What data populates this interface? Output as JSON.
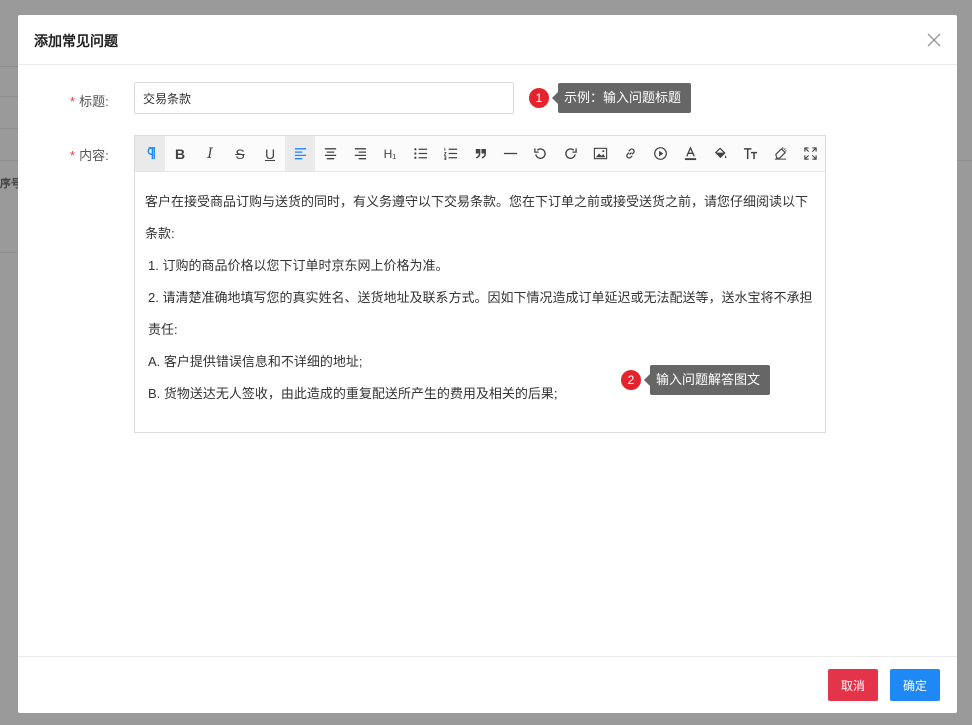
{
  "background": {
    "column_label": "序号"
  },
  "dialog": {
    "title": "添加常见问题",
    "close_icon": "close-icon"
  },
  "form": {
    "title_label": "标题:",
    "title_value": "交易条款",
    "content_label": "内容:",
    "required_mark": "*"
  },
  "tips": [
    {
      "badge": "1",
      "text": "示例：输入问题标题"
    },
    {
      "badge": "2",
      "text": "输入问题解答图文"
    }
  ],
  "toolbar": {
    "items": [
      {
        "name": "paragraph",
        "icon": "paragraph-icon"
      },
      {
        "name": "bold",
        "label": "B"
      },
      {
        "name": "italic",
        "label": "I"
      },
      {
        "name": "strikethrough",
        "label": "S"
      },
      {
        "name": "underline",
        "label": "U"
      },
      {
        "name": "align-left",
        "icon": "align-left-icon"
      },
      {
        "name": "align-center",
        "icon": "align-center-icon"
      },
      {
        "name": "align-right",
        "icon": "align-right-icon"
      },
      {
        "name": "heading",
        "label": "H₁"
      },
      {
        "name": "bulleted-list",
        "icon": "bulleted-list-icon"
      },
      {
        "name": "numbered-list",
        "icon": "numbered-list-icon"
      },
      {
        "name": "quote",
        "icon": "quote-icon"
      },
      {
        "name": "horizontal-rule",
        "icon": "horizontal-rule-icon"
      },
      {
        "name": "undo",
        "icon": "undo-icon"
      },
      {
        "name": "redo",
        "icon": "redo-icon"
      },
      {
        "name": "image",
        "icon": "image-icon"
      },
      {
        "name": "link",
        "icon": "link-icon"
      },
      {
        "name": "video",
        "icon": "video-icon"
      },
      {
        "name": "font-color",
        "icon": "font-color-icon"
      },
      {
        "name": "background-color",
        "icon": "paint-bucket-icon"
      },
      {
        "name": "font-size",
        "icon": "font-size-icon"
      },
      {
        "name": "clear-format",
        "icon": "clear-format-icon"
      },
      {
        "name": "fullscreen",
        "icon": "fullscreen-icon"
      }
    ]
  },
  "content": {
    "paragraphs": [
      "客户在接受商品订购与送货的同时，有义务遵守以下交易条款。您在下订单之前或接受送货之前，请您仔细阅读以下条款:",
      "1. 订购的商品价格以您下订单时京东网上价格为准。",
      "2. 请清楚准确地填写您的真实姓名、送货地址及联系方式。因如下情况造成订单延迟或无法配送等，送水宝将不承担责任:",
      "A. 客户提供错误信息和不详细的地址;",
      "B. 货物送达无人签收，由此造成的重复配送所产生的费用及相关的后果;"
    ]
  },
  "footer": {
    "cancel_label": "取消",
    "ok_label": "确定"
  },
  "colors": {
    "primary": "#1e88f5",
    "danger": "#e4344a",
    "badge": "#e4232c",
    "tip_bg": "#666666",
    "active_icon": "#1e88f5"
  }
}
